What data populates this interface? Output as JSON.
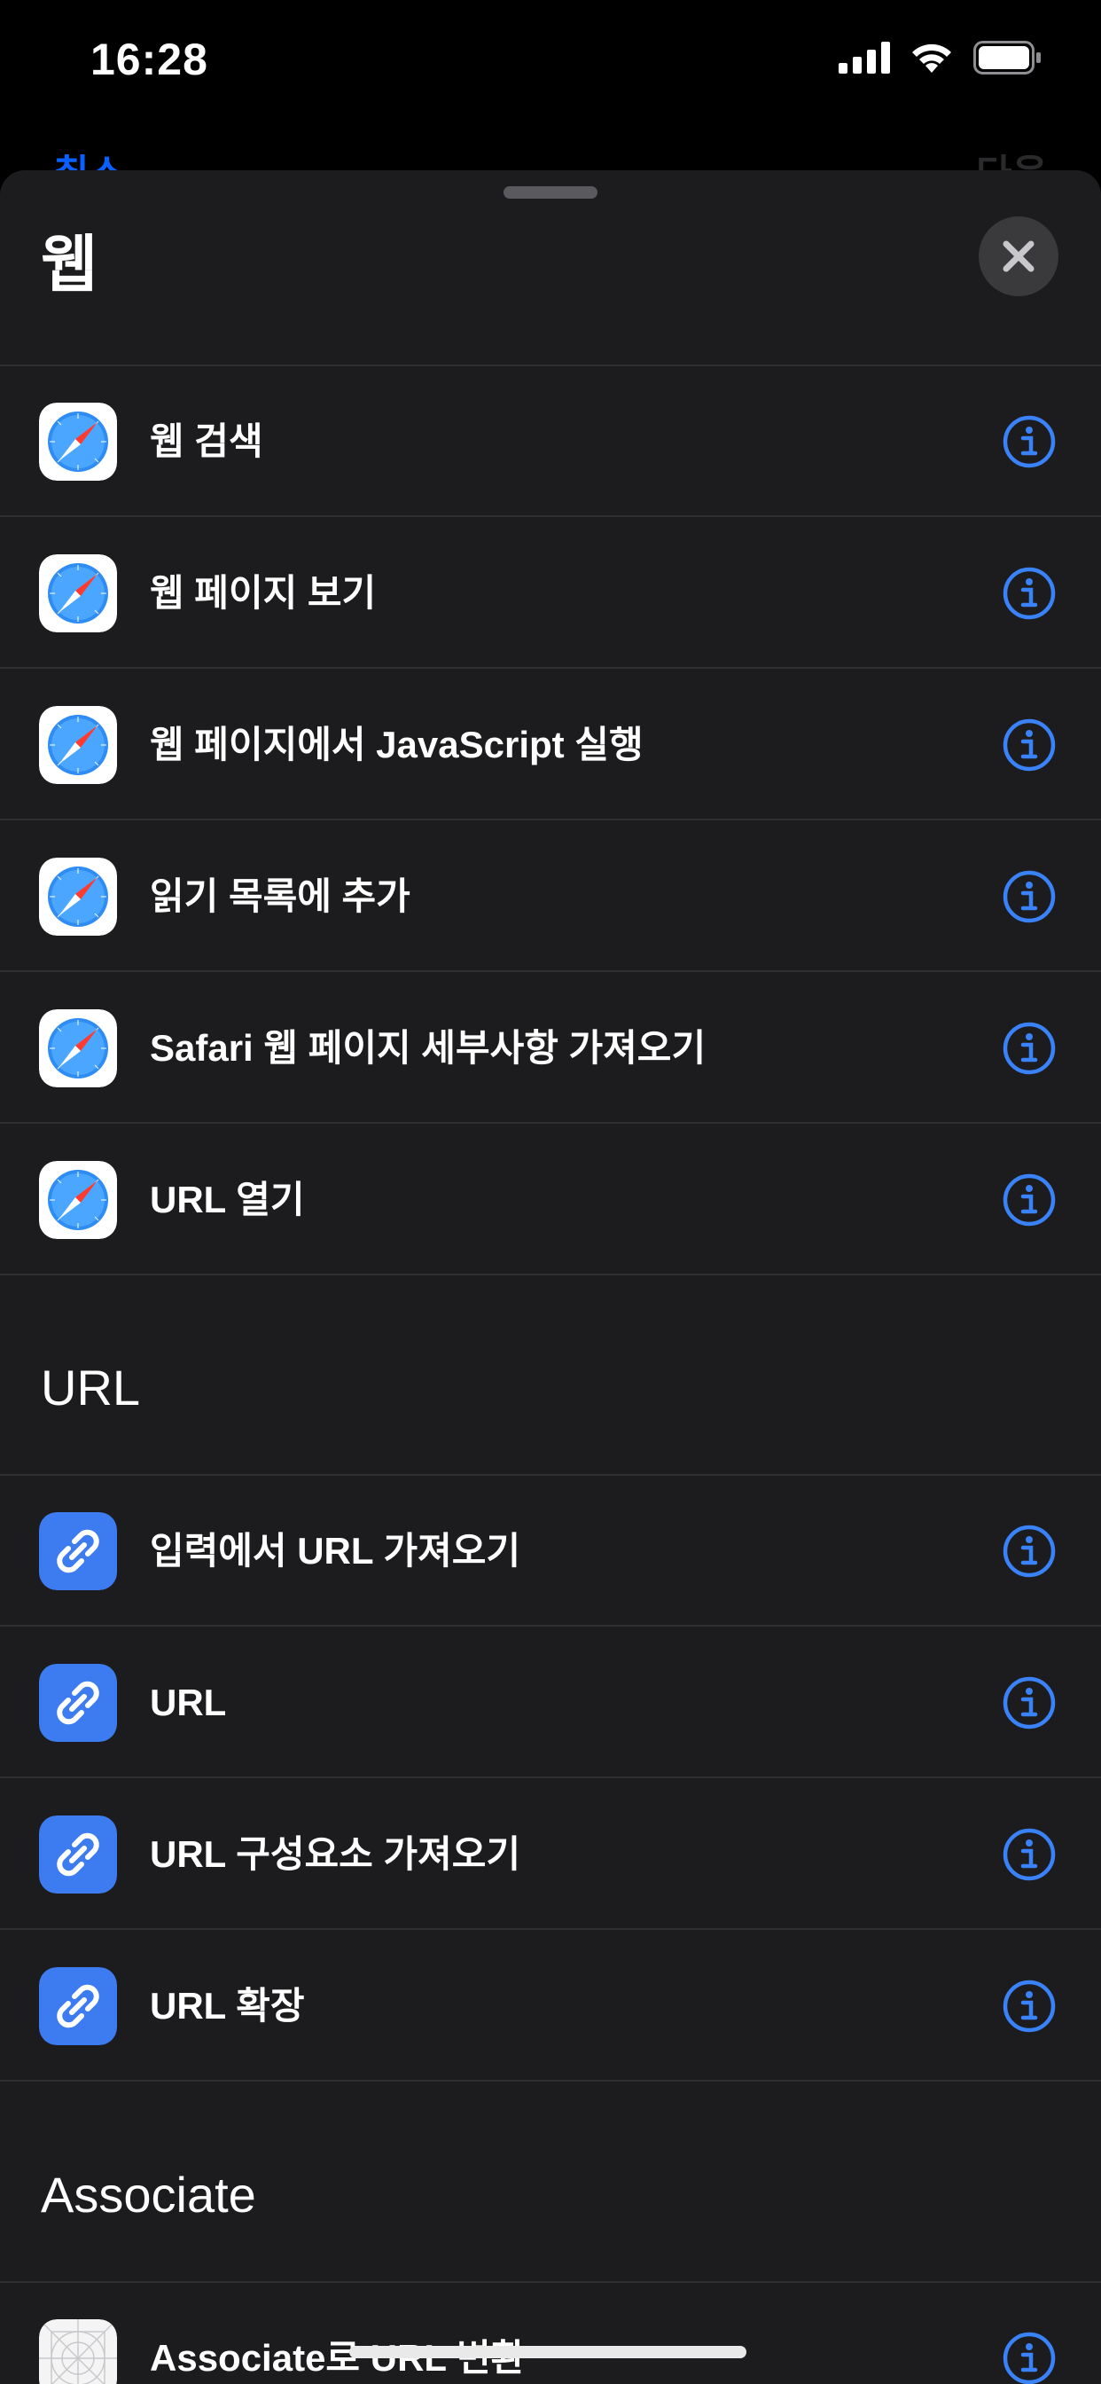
{
  "status_bar": {
    "time": "16:28"
  },
  "behind_nav": {
    "left": "취소",
    "right": "다음"
  },
  "sheet": {
    "title": "웹",
    "close_icon": "close-icon"
  },
  "sections": {
    "web": {
      "items": [
        {
          "label": "웹 검색",
          "icon": "safari-icon"
        },
        {
          "label": "웹 페이지 보기",
          "icon": "safari-icon"
        },
        {
          "label": "웹 페이지에서 JavaScript 실행",
          "icon": "safari-icon"
        },
        {
          "label": "읽기 목록에 추가",
          "icon": "safari-icon"
        },
        {
          "label": "Safari 웹 페이지 세부사항 가져오기",
          "icon": "safari-icon"
        },
        {
          "label": "URL 열기",
          "icon": "safari-icon"
        }
      ]
    },
    "url": {
      "header": "URL",
      "items": [
        {
          "label": "입력에서 URL 가져오기",
          "icon": "link-icon"
        },
        {
          "label": "URL",
          "icon": "link-icon"
        },
        {
          "label": "URL 구성요소 가져오기",
          "icon": "link-icon"
        },
        {
          "label": "URL 확장",
          "icon": "link-icon"
        }
      ]
    },
    "associate": {
      "header": "Associate",
      "items": [
        {
          "label": "Associate로 URL 변환",
          "icon": "associate-app-icon"
        }
      ]
    }
  },
  "colors": {
    "sheet_bg": "#1c1c1e",
    "accent_blue": "#3a82f7",
    "link_icon_bg": "#3d7cf0"
  }
}
